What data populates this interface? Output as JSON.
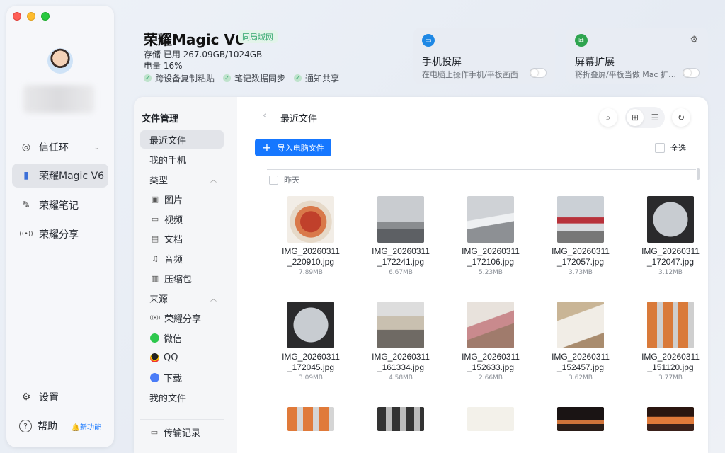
{
  "window": {
    "controls": [
      "close",
      "minimize",
      "maximize"
    ]
  },
  "sidebar": {
    "items": [
      {
        "label": "信任环",
        "icon": "trust-ring-icon",
        "glyph": "◎",
        "chev": "⌄"
      },
      {
        "label": "荣耀Magic V6",
        "icon": "book-icon",
        "glyph": "▮"
      },
      {
        "label": "荣耀笔记",
        "icon": "pen-icon",
        "glyph": "✎"
      },
      {
        "label": "荣耀分享",
        "icon": "share-signal-icon",
        "glyph": "((•))"
      }
    ],
    "settings": {
      "label": "设置",
      "glyph": "⚙"
    },
    "help": {
      "label": "帮助",
      "glyph": "?",
      "new_tag": "🔔新功能"
    }
  },
  "device": {
    "name": "荣耀Magic V6",
    "network_badge": "同局域网",
    "storage": "存储 已用 267.09GB/1024GB",
    "battery": "电量 16%",
    "features": [
      "跨设备复制粘贴",
      "笔记数据同步",
      "通知共享"
    ],
    "feature_check": "✓"
  },
  "cards": [
    {
      "title": "手机投屏",
      "subtitle": "在电脑上操作手机/平板画面",
      "icon_color": "#1e88e5",
      "glyph": "▭"
    },
    {
      "title": "屏幕扩展",
      "subtitle": "将折叠屏/平板当做 Mac 扩展屏",
      "icon_color": "#2ea44f",
      "glyph": "⧉",
      "gear": "⚙"
    }
  ],
  "files_nav": {
    "header": "文件管理",
    "recent": "最近文件",
    "my_phone": "我的手机",
    "types_label": "类型",
    "types": [
      {
        "label": "图片",
        "glyph": "▣"
      },
      {
        "label": "视频",
        "glyph": "▭"
      },
      {
        "label": "文档",
        "glyph": "▤"
      },
      {
        "label": "音频",
        "glyph": "♫"
      },
      {
        "label": "压缩包",
        "glyph": "▥"
      }
    ],
    "source_label": "来源",
    "sources": [
      {
        "label": "荣耀分享",
        "color": "#ffffff",
        "glyph": "((•))"
      },
      {
        "label": "微信",
        "color": "#2dc84d"
      },
      {
        "label": "QQ",
        "color": "#222222"
      },
      {
        "label": "下载",
        "color": "#4a7cf7"
      }
    ],
    "my_files": "我的文件",
    "transfer": "传输记录",
    "collapse_glyph": "︿"
  },
  "content": {
    "title": "最近文件",
    "back_glyph": "‹",
    "import_label": "导入电脑文件",
    "import_glyph": "+",
    "select_all": "全选",
    "group_label": "昨天",
    "search_glyph": "⌕",
    "grid_glyph": "⊞",
    "list_glyph": "☰",
    "refresh_glyph": "↻",
    "files": [
      {
        "name": "IMG_20260311_220910.jpg",
        "size": "7.89MB",
        "kind": "food"
      },
      {
        "name": "IMG_20260311_172241.jpg",
        "size": "6.67MB",
        "kind": "runway"
      },
      {
        "name": "IMG_20260311_172106.jpg",
        "size": "5.23MB",
        "kind": "wing"
      },
      {
        "name": "IMG_20260311_172057.jpg",
        "size": "3.73MB",
        "kind": "plane"
      },
      {
        "name": "IMG_20260311_172047.jpg",
        "size": "3.12MB",
        "kind": "window"
      },
      {
        "name": "IMG_20260311_172045.jpg",
        "size": "3.09MB",
        "kind": "window"
      },
      {
        "name": "IMG_20260311_161334.jpg",
        "size": "4.58MB",
        "kind": "hall"
      },
      {
        "name": "IMG_20260311_152633.jpg",
        "size": "2.66MB",
        "kind": "box"
      },
      {
        "name": "IMG_20260311_152457.jpg",
        "size": "3.62MB",
        "kind": "card"
      },
      {
        "name": "IMG_20260311_151120.jpg",
        "size": "3.77MB",
        "kind": "grid"
      },
      {
        "name": "",
        "size": "",
        "kind": "grid2"
      },
      {
        "name": "",
        "size": "",
        "kind": "dark"
      },
      {
        "name": "",
        "size": "",
        "kind": "doc"
      },
      {
        "name": "",
        "size": "",
        "kind": "stage"
      },
      {
        "name": "",
        "size": "",
        "kind": "stage2"
      }
    ]
  }
}
